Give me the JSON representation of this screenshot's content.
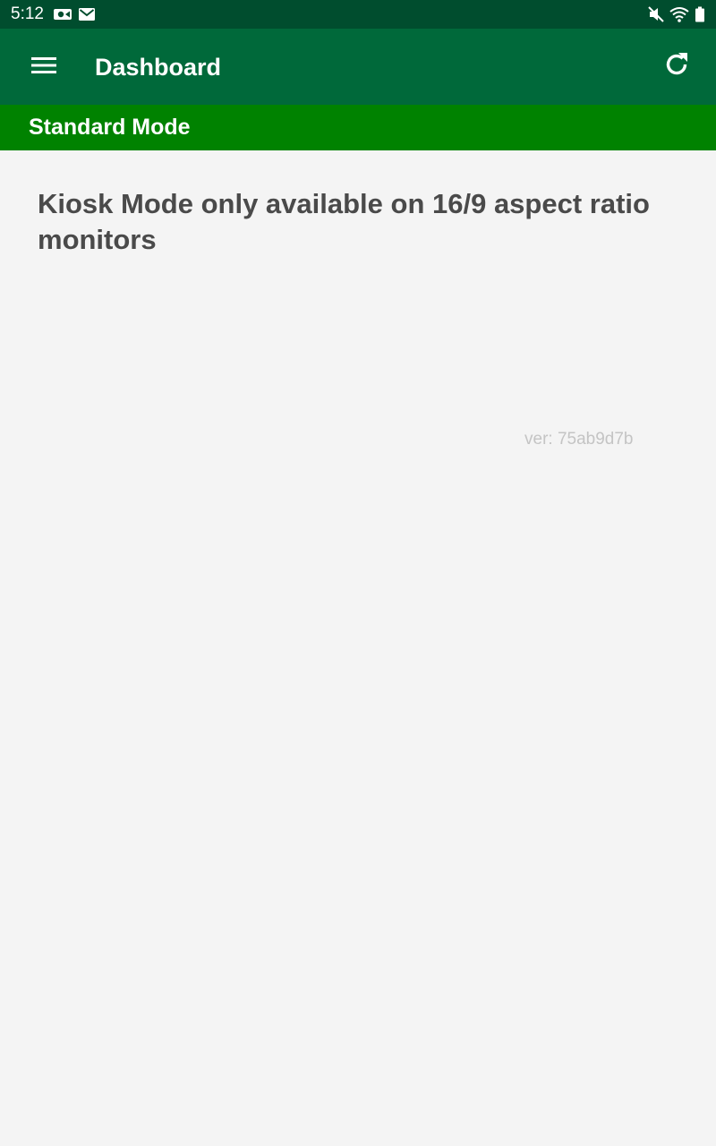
{
  "status_bar": {
    "time": "5:12",
    "left_icons": [
      "video-camera-icon",
      "mail-icon"
    ],
    "right_icons": [
      "mute-icon",
      "wifi-icon",
      "battery-icon"
    ]
  },
  "app_bar": {
    "menu_icon": "hamburger-menu-icon",
    "title": "Dashboard",
    "refresh_icon": "refresh-icon",
    "background": "#00693a"
  },
  "mode_bar": {
    "label": "Standard Mode",
    "background": "#008200"
  },
  "content": {
    "message": "Kiosk Mode only available on 16/9 aspect ratio monitors",
    "version": "ver: 75ab9d7b"
  },
  "colors": {
    "status_bar": "#004d2e",
    "page_background": "#f4f4f4",
    "message_text": "#4a4a4a",
    "version_text": "#c4c4c4"
  }
}
